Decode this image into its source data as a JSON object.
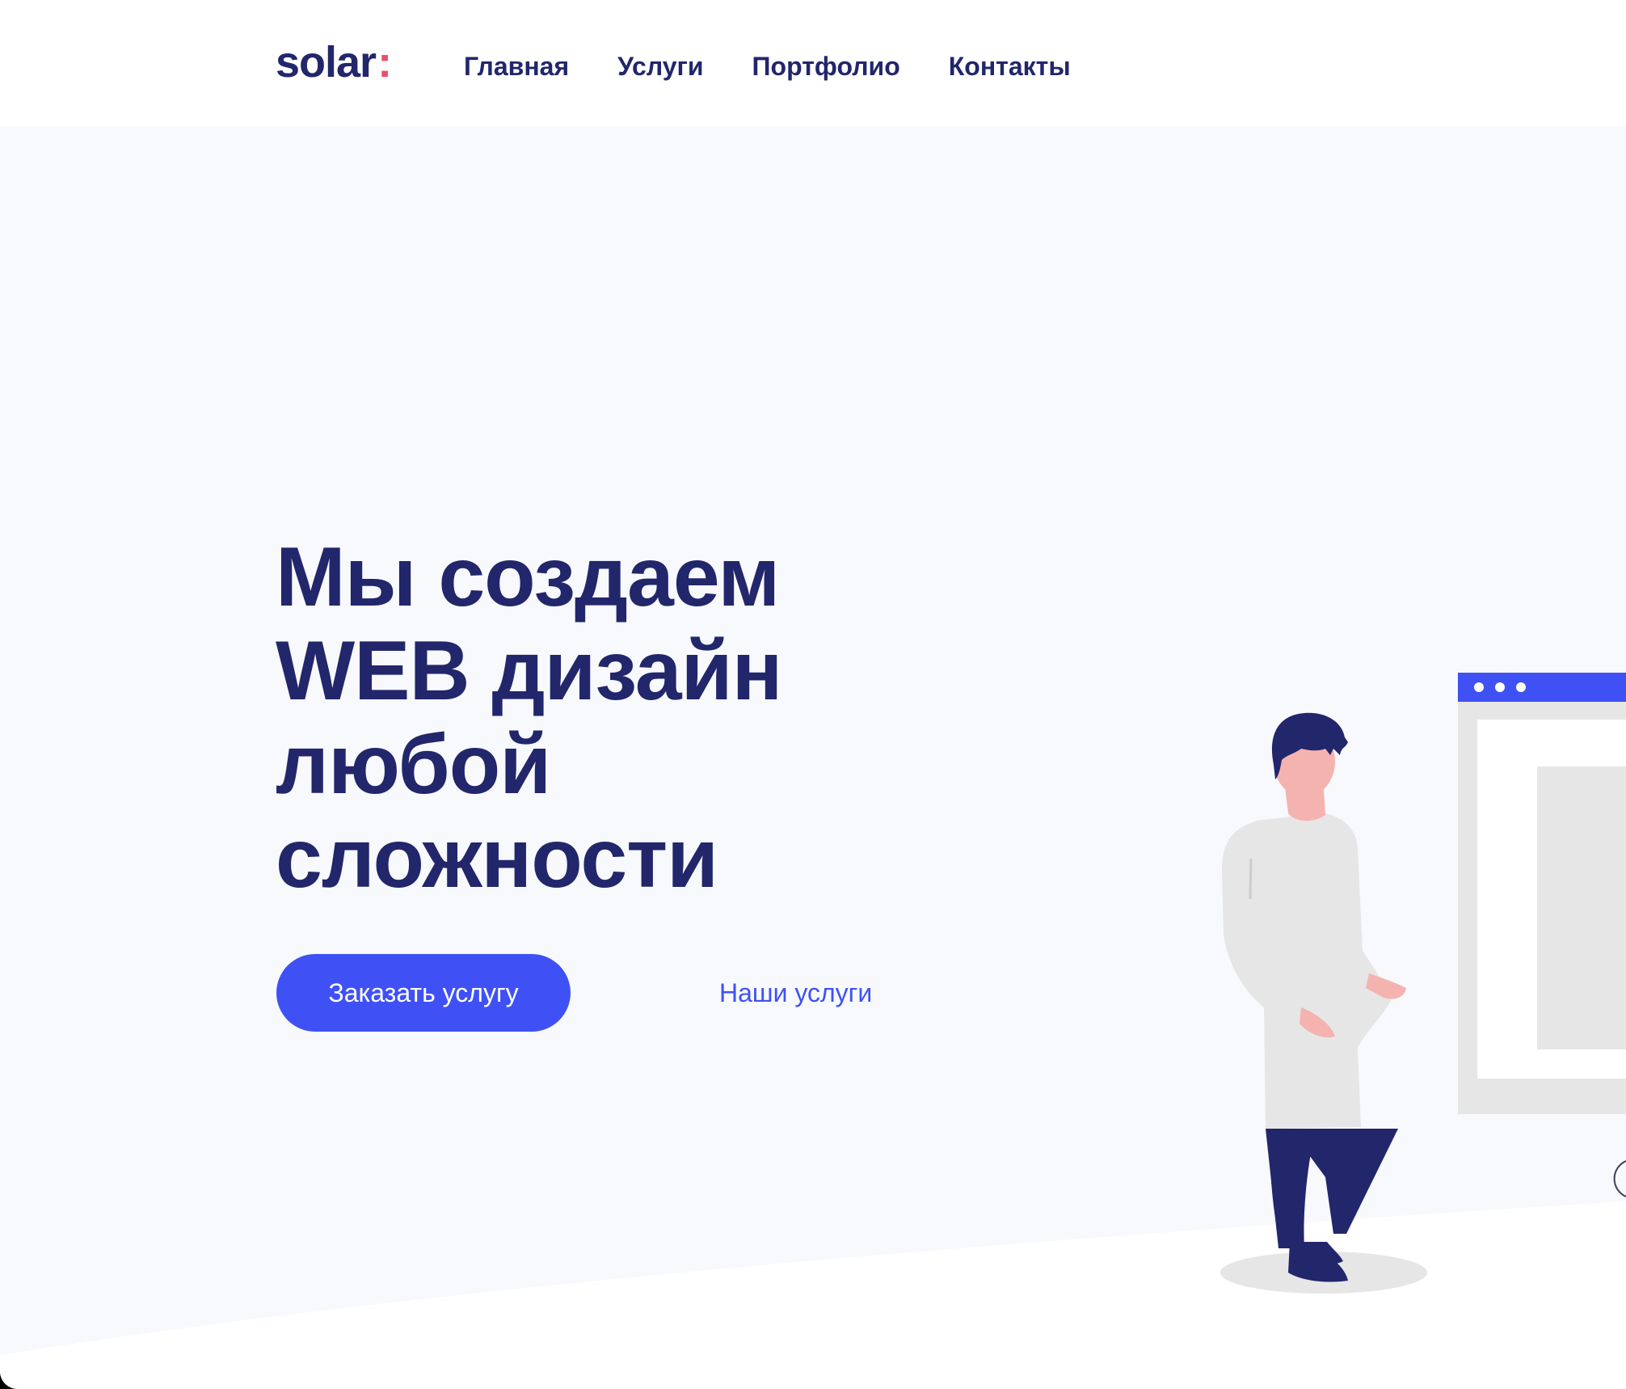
{
  "header": {
    "logo_text": "solar",
    "logo_colon": ":",
    "nav": [
      {
        "label": "Главная"
      },
      {
        "label": "Услуги"
      },
      {
        "label": "Портфолио"
      },
      {
        "label": "Контакты"
      }
    ]
  },
  "hero": {
    "headline_lines": [
      "Мы создаем",
      "WEB дизайн",
      "любой",
      "сложности"
    ],
    "primary_button": "Заказать услугу",
    "secondary_link": "Наши услуги"
  },
  "colors": {
    "brand_dark": "#22266b",
    "accent_blue": "#3f51f5",
    "logo_colon": "#ef4b6c",
    "hero_background": "#f7f9fd"
  },
  "icons": [
    "person-illustration",
    "browser-window-illustration"
  ]
}
